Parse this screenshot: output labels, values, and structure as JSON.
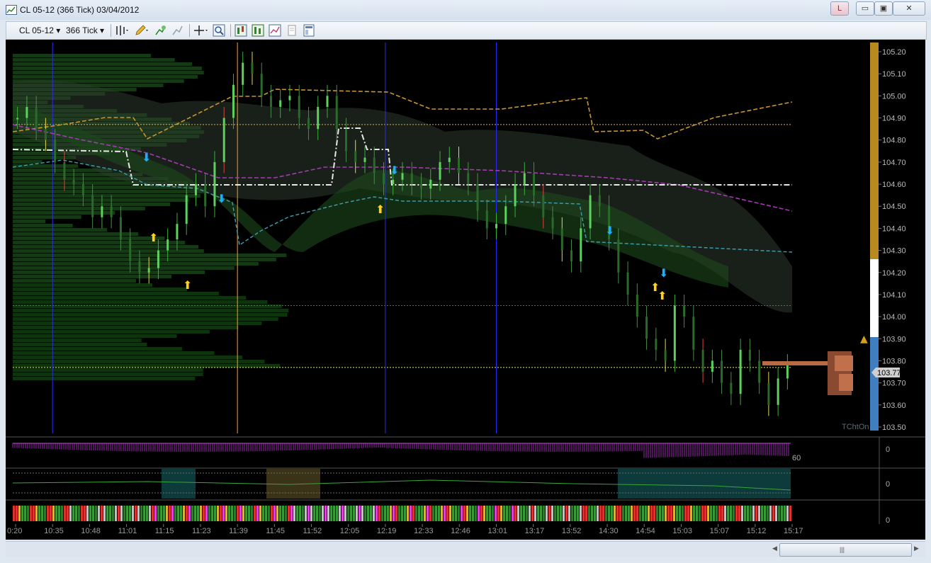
{
  "window": {
    "title": "CL 05-12 (366 Tick)  03/04/2012",
    "link_label": "L",
    "min_glyph": "▭",
    "max_glyph": "▣",
    "close_glyph": "✕"
  },
  "toolbar": {
    "instrument": "CL 05-12",
    "interval": "366 Tick",
    "dropdown_glyph": "▾",
    "icons": [
      "bar-type-icon",
      "drawing-pencil-icon",
      "add-indicator-icon",
      "remove-indicator-icon",
      "crosshair-icon",
      "zoom-icon",
      "strategy-icon",
      "chart-trader-icon",
      "properties-icon",
      "data-box-icon",
      "template-icon"
    ]
  },
  "chart_data": {
    "type": "candlestick",
    "price_axis": {
      "ticks": [
        "105.20",
        "105.10",
        "105.00",
        "104.90",
        "104.80",
        "104.70",
        "104.60",
        "104.50",
        "104.40",
        "104.30",
        "104.20",
        "104.10",
        "104.00",
        "103.90",
        "103.80",
        "103.70",
        "103.60",
        "103.50"
      ],
      "ylim": [
        103.5,
        105.2
      ],
      "last_price": "103.77"
    },
    "time_axis": {
      "ticks": [
        "0:20",
        "10:35",
        "10:48",
        "11:01",
        "11:15",
        "11:23",
        "11:39",
        "11:45",
        "11:52",
        "12:05",
        "12:19",
        "12:33",
        "12:46",
        "13:01",
        "13:17",
        "13:52",
        "14:30",
        "14:54",
        "15:03",
        "15:07",
        "15:12",
        "15:17"
      ]
    },
    "vertical_lines": [
      {
        "color": "#2a2aff",
        "at": "10:35"
      },
      {
        "color": "#ff9a2e",
        "at": "11:39"
      },
      {
        "color": "#2a2aff",
        "at": "12:19"
      },
      {
        "color": "#2a2aff",
        "at": "13:01"
      }
    ],
    "horizontal_lines": [
      {
        "color": "#e6b24a",
        "value": 104.87
      },
      {
        "color": "#e03030",
        "value": 104.05
      },
      {
        "color": "#e8e870",
        "value": 103.77
      }
    ],
    "series": [
      {
        "values": [
          104.9,
          104.95,
          104.85,
          104.8,
          104.7,
          104.62,
          104.6,
          104.55,
          104.45,
          104.5,
          104.45,
          104.35,
          104.25,
          104.2,
          104.22,
          104.3,
          104.35,
          104.42,
          104.55,
          104.6,
          104.5,
          104.7,
          104.9,
          105.05,
          105.15,
          105.1,
          105.0,
          104.95,
          104.98,
          105.0,
          104.9,
          104.85,
          104.95,
          105.0,
          104.85,
          104.75,
          104.7,
          104.72,
          104.65,
          104.6,
          104.62,
          104.65,
          104.6,
          104.58,
          104.62,
          104.7,
          104.72,
          104.65,
          104.6,
          104.48,
          104.4,
          104.42,
          104.5,
          104.6,
          104.65,
          104.55,
          104.45,
          104.4,
          104.3,
          104.25,
          104.4,
          104.55,
          104.5,
          104.35,
          104.2,
          104.1,
          104.0,
          103.9,
          103.85,
          103.8,
          104.05,
          104.0,
          103.85,
          103.75,
          103.8,
          103.7,
          103.65,
          103.85,
          103.8,
          103.7,
          103.6,
          103.72,
          103.78
        ]
      }
    ],
    "indicator_panels": [
      {
        "label": "60",
        "zero": "0"
      },
      {
        "label": "",
        "zero": "0"
      },
      {
        "label": "",
        "zero": "0"
      }
    ],
    "watermark": "TChtOn"
  }
}
